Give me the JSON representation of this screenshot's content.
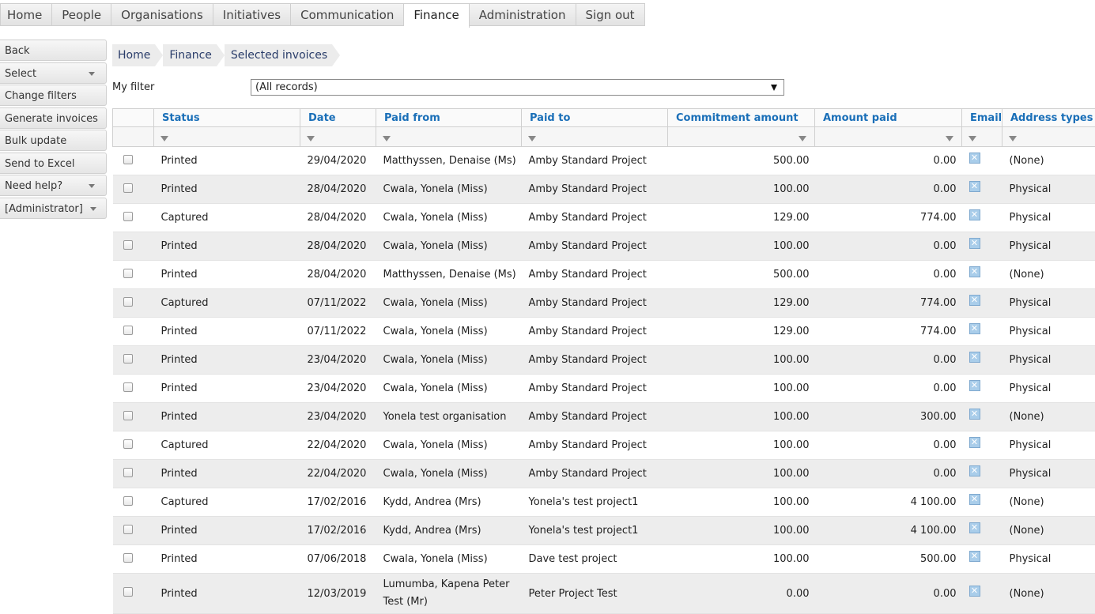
{
  "nav": {
    "tabs": [
      {
        "label": "Home"
      },
      {
        "label": "People"
      },
      {
        "label": "Organisations"
      },
      {
        "label": "Initiatives"
      },
      {
        "label": "Communication"
      },
      {
        "label": "Finance"
      },
      {
        "label": "Administration"
      },
      {
        "label": "Sign out"
      }
    ],
    "active": "Finance"
  },
  "sidebar": {
    "items": [
      {
        "label": "Back",
        "dropdown": false
      },
      {
        "label": "Select",
        "dropdown": true
      },
      {
        "label": "Change filters",
        "dropdown": false
      },
      {
        "label": "Generate invoices",
        "dropdown": false
      },
      {
        "label": "Bulk update",
        "dropdown": false
      },
      {
        "label": "Send to Excel",
        "dropdown": false
      },
      {
        "label": "Need help?",
        "dropdown": true
      },
      {
        "label": "[Administrator]",
        "dropdown": true
      }
    ]
  },
  "breadcrumb": {
    "items": [
      "Home",
      "Finance",
      "Selected invoices"
    ]
  },
  "filter": {
    "label": "My filter",
    "value": "(All records)"
  },
  "table": {
    "columns": [
      "Status",
      "Date",
      "Paid from",
      "Paid to",
      "Commitment amount",
      "Amount paid",
      "Email",
      "Address types"
    ],
    "rows": [
      {
        "status": "Printed",
        "date": "29/04/2020",
        "paid_from": "Matthyssen, Denaise (Ms)",
        "paid_to": "Amby Standard Project",
        "commitment": "500.00",
        "paid": "0.00",
        "address": "(None)"
      },
      {
        "status": "Printed",
        "date": "28/04/2020",
        "paid_from": "Cwala, Yonela (Miss)",
        "paid_to": "Amby Standard Project",
        "commitment": "100.00",
        "paid": "0.00",
        "address": "Physical"
      },
      {
        "status": "Captured",
        "date": "28/04/2020",
        "paid_from": "Cwala, Yonela (Miss)",
        "paid_to": "Amby Standard Project",
        "commitment": "129.00",
        "paid": "774.00",
        "address": "Physical"
      },
      {
        "status": "Printed",
        "date": "28/04/2020",
        "paid_from": "Cwala, Yonela (Miss)",
        "paid_to": "Amby Standard Project",
        "commitment": "100.00",
        "paid": "0.00",
        "address": "Physical"
      },
      {
        "status": "Printed",
        "date": "28/04/2020",
        "paid_from": "Matthyssen, Denaise (Ms)",
        "paid_to": "Amby Standard Project",
        "commitment": "500.00",
        "paid": "0.00",
        "address": "(None)"
      },
      {
        "status": "Captured",
        "date": "07/11/2022",
        "paid_from": "Cwala, Yonela (Miss)",
        "paid_to": "Amby Standard Project",
        "commitment": "129.00",
        "paid": "774.00",
        "address": "Physical"
      },
      {
        "status": "Printed",
        "date": "07/11/2022",
        "paid_from": "Cwala, Yonela (Miss)",
        "paid_to": "Amby Standard Project",
        "commitment": "129.00",
        "paid": "774.00",
        "address": "Physical"
      },
      {
        "status": "Printed",
        "date": "23/04/2020",
        "paid_from": "Cwala, Yonela (Miss)",
        "paid_to": "Amby Standard Project",
        "commitment": "100.00",
        "paid": "0.00",
        "address": "Physical"
      },
      {
        "status": "Printed",
        "date": "23/04/2020",
        "paid_from": "Cwala, Yonela (Miss)",
        "paid_to": "Amby Standard Project",
        "commitment": "100.00",
        "paid": "0.00",
        "address": "Physical"
      },
      {
        "status": "Printed",
        "date": "23/04/2020",
        "paid_from": "Yonela test organisation",
        "paid_to": "Amby Standard Project",
        "commitment": "100.00",
        "paid": "300.00",
        "address": "(None)"
      },
      {
        "status": "Captured",
        "date": "22/04/2020",
        "paid_from": "Cwala, Yonela (Miss)",
        "paid_to": "Amby Standard Project",
        "commitment": "100.00",
        "paid": "0.00",
        "address": "Physical"
      },
      {
        "status": "Printed",
        "date": "22/04/2020",
        "paid_from": "Cwala, Yonela (Miss)",
        "paid_to": "Amby Standard Project",
        "commitment": "100.00",
        "paid": "0.00",
        "address": "Physical"
      },
      {
        "status": "Captured",
        "date": "17/02/2016",
        "paid_from": "Kydd, Andrea (Mrs)",
        "paid_to": "Yonela's test project1",
        "commitment": "100.00",
        "paid": "4 100.00",
        "address": "(None)"
      },
      {
        "status": "Printed",
        "date": "17/02/2016",
        "paid_from": "Kydd, Andrea (Mrs)",
        "paid_to": "Yonela's test project1",
        "commitment": "100.00",
        "paid": "4 100.00",
        "address": "(None)"
      },
      {
        "status": "Printed",
        "date": "07/06/2018",
        "paid_from": "Cwala, Yonela (Miss)",
        "paid_to": "Dave test project",
        "commitment": "100.00",
        "paid": "500.00",
        "address": "Physical"
      },
      {
        "status": "Printed",
        "date": "12/03/2019",
        "paid_from": "Lumumba, Kapena Peter Test (Mr)",
        "paid_to": "Peter Project Test",
        "commitment": "0.00",
        "paid": "0.00",
        "address": "(None)"
      }
    ]
  }
}
